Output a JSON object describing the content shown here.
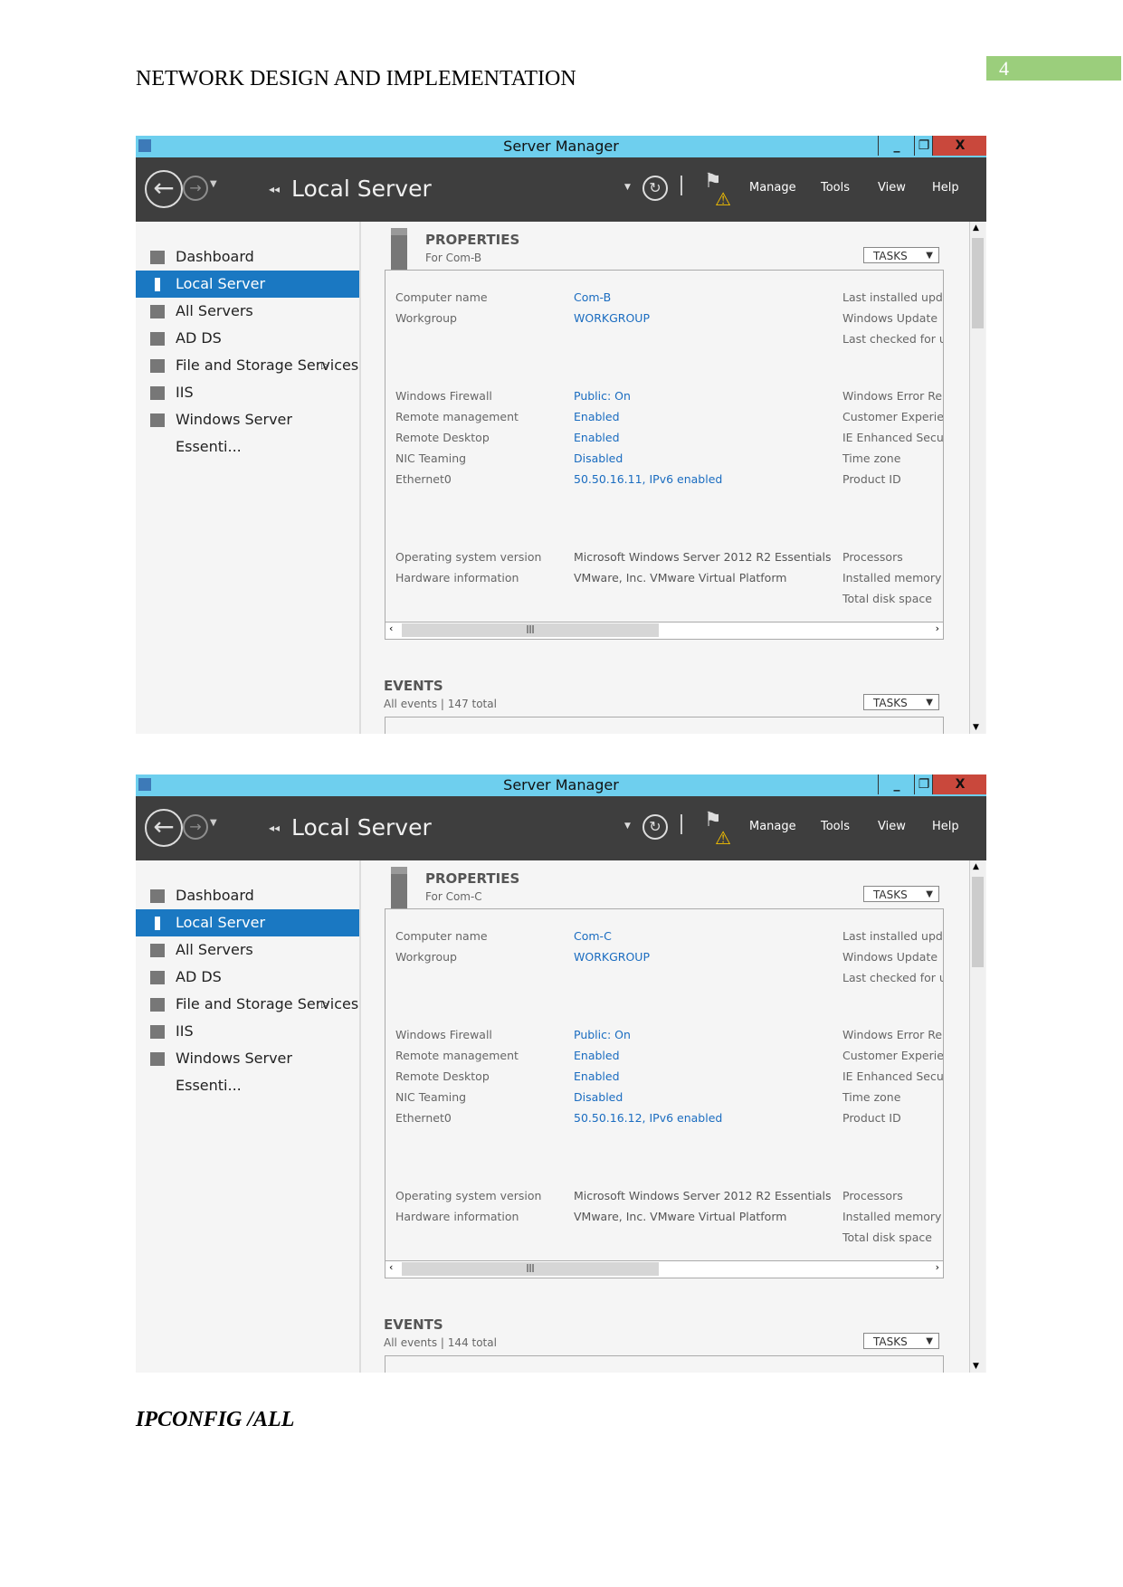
{
  "document": {
    "header": "NETWORK DESIGN AND IMPLEMENTATION",
    "page_number": "4",
    "caption": "IPCONFIG /ALL"
  },
  "windows": [
    {
      "title": "Server Manager",
      "breadcrumb": "Local Server",
      "menu": [
        "Manage",
        "Tools",
        "View",
        "Help"
      ],
      "sidebar": [
        "Dashboard",
        "Local Server",
        "All Servers",
        "AD DS",
        "File and Storage Services",
        "IIS",
        "Windows Server Essenti..."
      ],
      "properties": {
        "heading": "PROPERTIES",
        "for": "For Com-B",
        "tasks": "TASKS",
        "rows": [
          {
            "label": "Computer name",
            "value": "Com-B",
            "right": "Last installed upd"
          },
          {
            "label": "Workgroup",
            "value": "WORKGROUP",
            "right": "Windows Update"
          },
          {
            "label": "",
            "value": "",
            "right": "Last checked for u"
          },
          {
            "label": "Windows Firewall",
            "value": "Public: On",
            "right": "Windows Error Re"
          },
          {
            "label": "Remote management",
            "value": "Enabled",
            "right": "Customer Experie"
          },
          {
            "label": "Remote Desktop",
            "value": "Enabled",
            "right": "IE Enhanced Secu"
          },
          {
            "label": "NIC Teaming",
            "value": "Disabled",
            "right": "Time zone"
          },
          {
            "label": "Ethernet0",
            "value": "50.50.16.11, IPv6 enabled",
            "right": "Product ID"
          },
          {
            "label": "Operating system version",
            "value": "Microsoft Windows Server 2012 R2 Essentials",
            "right": "Processors"
          },
          {
            "label": "Hardware information",
            "value": "VMware, Inc. VMware Virtual Platform",
            "right": "Installed memory"
          },
          {
            "label": "",
            "value": "",
            "right": "Total disk space"
          }
        ]
      },
      "events": {
        "heading": "EVENTS",
        "summary": "All events | 147 total",
        "tasks": "TASKS"
      }
    },
    {
      "title": "Server Manager",
      "breadcrumb": "Local Server",
      "menu": [
        "Manage",
        "Tools",
        "View",
        "Help"
      ],
      "sidebar": [
        "Dashboard",
        "Local Server",
        "All Servers",
        "AD DS",
        "File and Storage Services",
        "IIS",
        "Windows Server Essenti..."
      ],
      "properties": {
        "heading": "PROPERTIES",
        "for": "For Com-C",
        "tasks": "TASKS",
        "rows": [
          {
            "label": "Computer name",
            "value": "Com-C",
            "right": "Last installed upd"
          },
          {
            "label": "Workgroup",
            "value": "WORKGROUP",
            "right": "Windows Update"
          },
          {
            "label": "",
            "value": "",
            "right": "Last checked for u"
          },
          {
            "label": "Windows Firewall",
            "value": "Public: On",
            "right": "Windows Error Re"
          },
          {
            "label": "Remote management",
            "value": "Enabled",
            "right": "Customer Experie"
          },
          {
            "label": "Remote Desktop",
            "value": "Enabled",
            "right": "IE Enhanced Secu"
          },
          {
            "label": "NIC Teaming",
            "value": "Disabled",
            "right": "Time zone"
          },
          {
            "label": "Ethernet0",
            "value": "50.50.16.12, IPv6 enabled",
            "right": "Product ID"
          },
          {
            "label": "Operating system version",
            "value": "Microsoft Windows Server 2012 R2 Essentials",
            "right": "Processors"
          },
          {
            "label": "Hardware information",
            "value": "VMware, Inc. VMware Virtual Platform",
            "right": "Installed memory"
          },
          {
            "label": "",
            "value": "",
            "right": "Total disk space"
          }
        ]
      },
      "events": {
        "heading": "EVENTS",
        "summary": "All events | 144 total",
        "tasks": "TASKS"
      }
    }
  ],
  "colors": {
    "titlebar": "#6ecfee",
    "toolbar": "#3e3e3e",
    "selected": "#1a78c2",
    "link": "#1a6cc0",
    "close": "#c9483c",
    "page_number_bg": "#9bce7c"
  }
}
